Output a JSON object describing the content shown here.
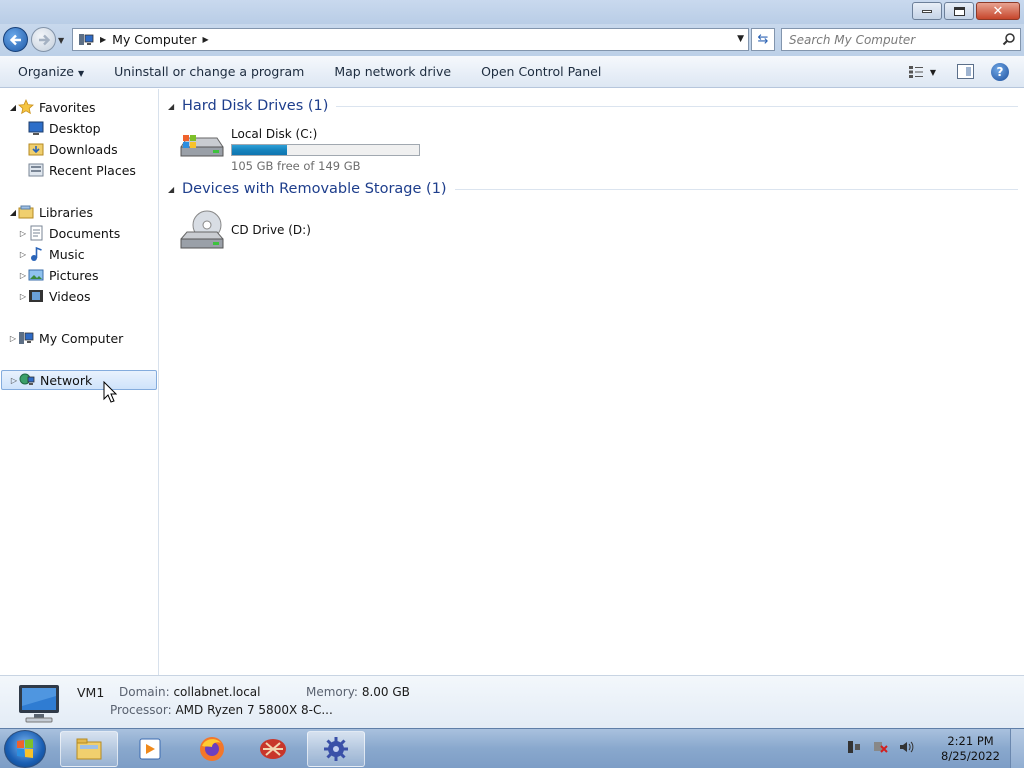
{
  "window": {
    "controls": {
      "minimize": "minimize",
      "maximize": "maximize",
      "close": "close"
    }
  },
  "address": {
    "breadcrumb": [
      "My Computer"
    ],
    "search_placeholder": "Search My Computer"
  },
  "toolbar": {
    "organize": "Organize",
    "uninstall": "Uninstall or change a program",
    "map_drive": "Map network drive",
    "control_panel": "Open Control Panel"
  },
  "nav": {
    "favorites": "Favorites",
    "desktop": "Desktop",
    "downloads": "Downloads",
    "recent_places": "Recent Places",
    "libraries": "Libraries",
    "documents": "Documents",
    "music": "Music",
    "pictures": "Pictures",
    "videos": "Videos",
    "my_computer": "My Computer",
    "network": "Network"
  },
  "groups": {
    "hard_disks": "Hard Disk Drives (1)",
    "removable": "Devices with Removable Storage (1)"
  },
  "drives": {
    "c": {
      "name": "Local Disk (C:)",
      "free_text": "105 GB free of 149 GB",
      "used_fraction": 0.295
    },
    "d": {
      "name": "CD Drive (D:)"
    }
  },
  "details": {
    "computer_name": "VM1",
    "domain_label": "Domain:",
    "domain_value": "collabnet.local",
    "memory_label": "Memory:",
    "memory_value": "8.00 GB",
    "processor_label": "Processor:",
    "processor_value": "AMD Ryzen 7 5800X 8-C..."
  },
  "taskbar": {
    "time": "2:21 PM",
    "date": "8/25/2022"
  },
  "colors": {
    "accent": "#1e3e8c",
    "drive_bar": "#1683bd"
  }
}
